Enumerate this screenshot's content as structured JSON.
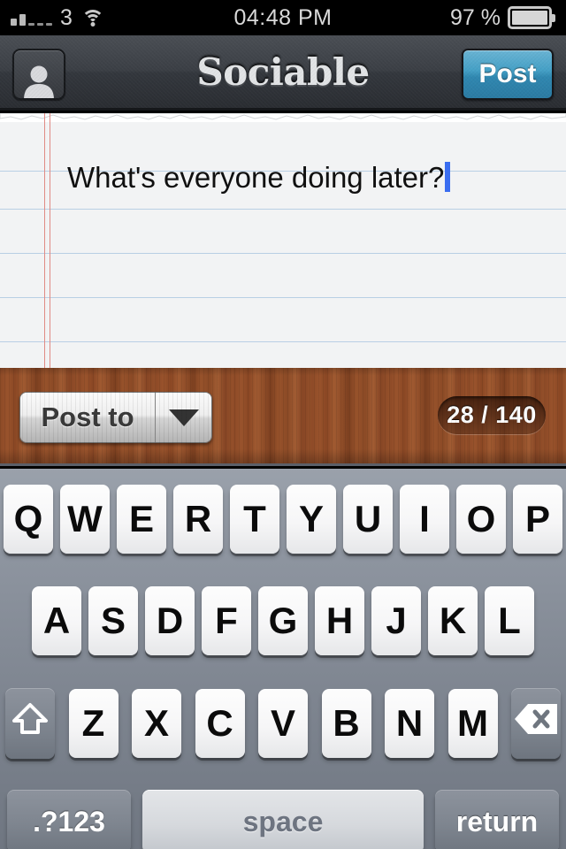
{
  "status_bar": {
    "signal_icon": "signal-bars-icon",
    "carrier": "3",
    "wifi_icon": "wifi-icon",
    "time": "04:48 PM",
    "battery_percent": "97 %",
    "battery_icon": "battery-icon"
  },
  "nav_bar": {
    "title": "Sociable",
    "avatar_icon": "person-avatar-icon",
    "post_label": "Post"
  },
  "composer": {
    "text": "What's everyone doing later?",
    "caret_visible": true
  },
  "toolbar": {
    "post_to_label": "Post to",
    "dropdown_icon": "chevron-down-icon",
    "char_counter": "28 / 140"
  },
  "keyboard": {
    "row1": [
      "Q",
      "W",
      "E",
      "R",
      "T",
      "Y",
      "U",
      "I",
      "O",
      "P"
    ],
    "row2": [
      "A",
      "S",
      "D",
      "F",
      "G",
      "H",
      "J",
      "K",
      "L"
    ],
    "row3": [
      "Z",
      "X",
      "C",
      "V",
      "B",
      "N",
      "M"
    ],
    "shift_icon": "shift-arrow-icon",
    "backspace_icon": "backspace-delete-icon",
    "numbers_label": ".?123",
    "space_label": "space",
    "return_label": "return"
  },
  "colors": {
    "accent_blue": "#2f87b0",
    "caret_blue": "#3a6df0",
    "paper": "#f2f3f4",
    "rule_line": "#b9cfe4",
    "margin_line": "#e08a84",
    "wood": "#8d4a27",
    "keyboard_bg": "#8e95a0"
  }
}
